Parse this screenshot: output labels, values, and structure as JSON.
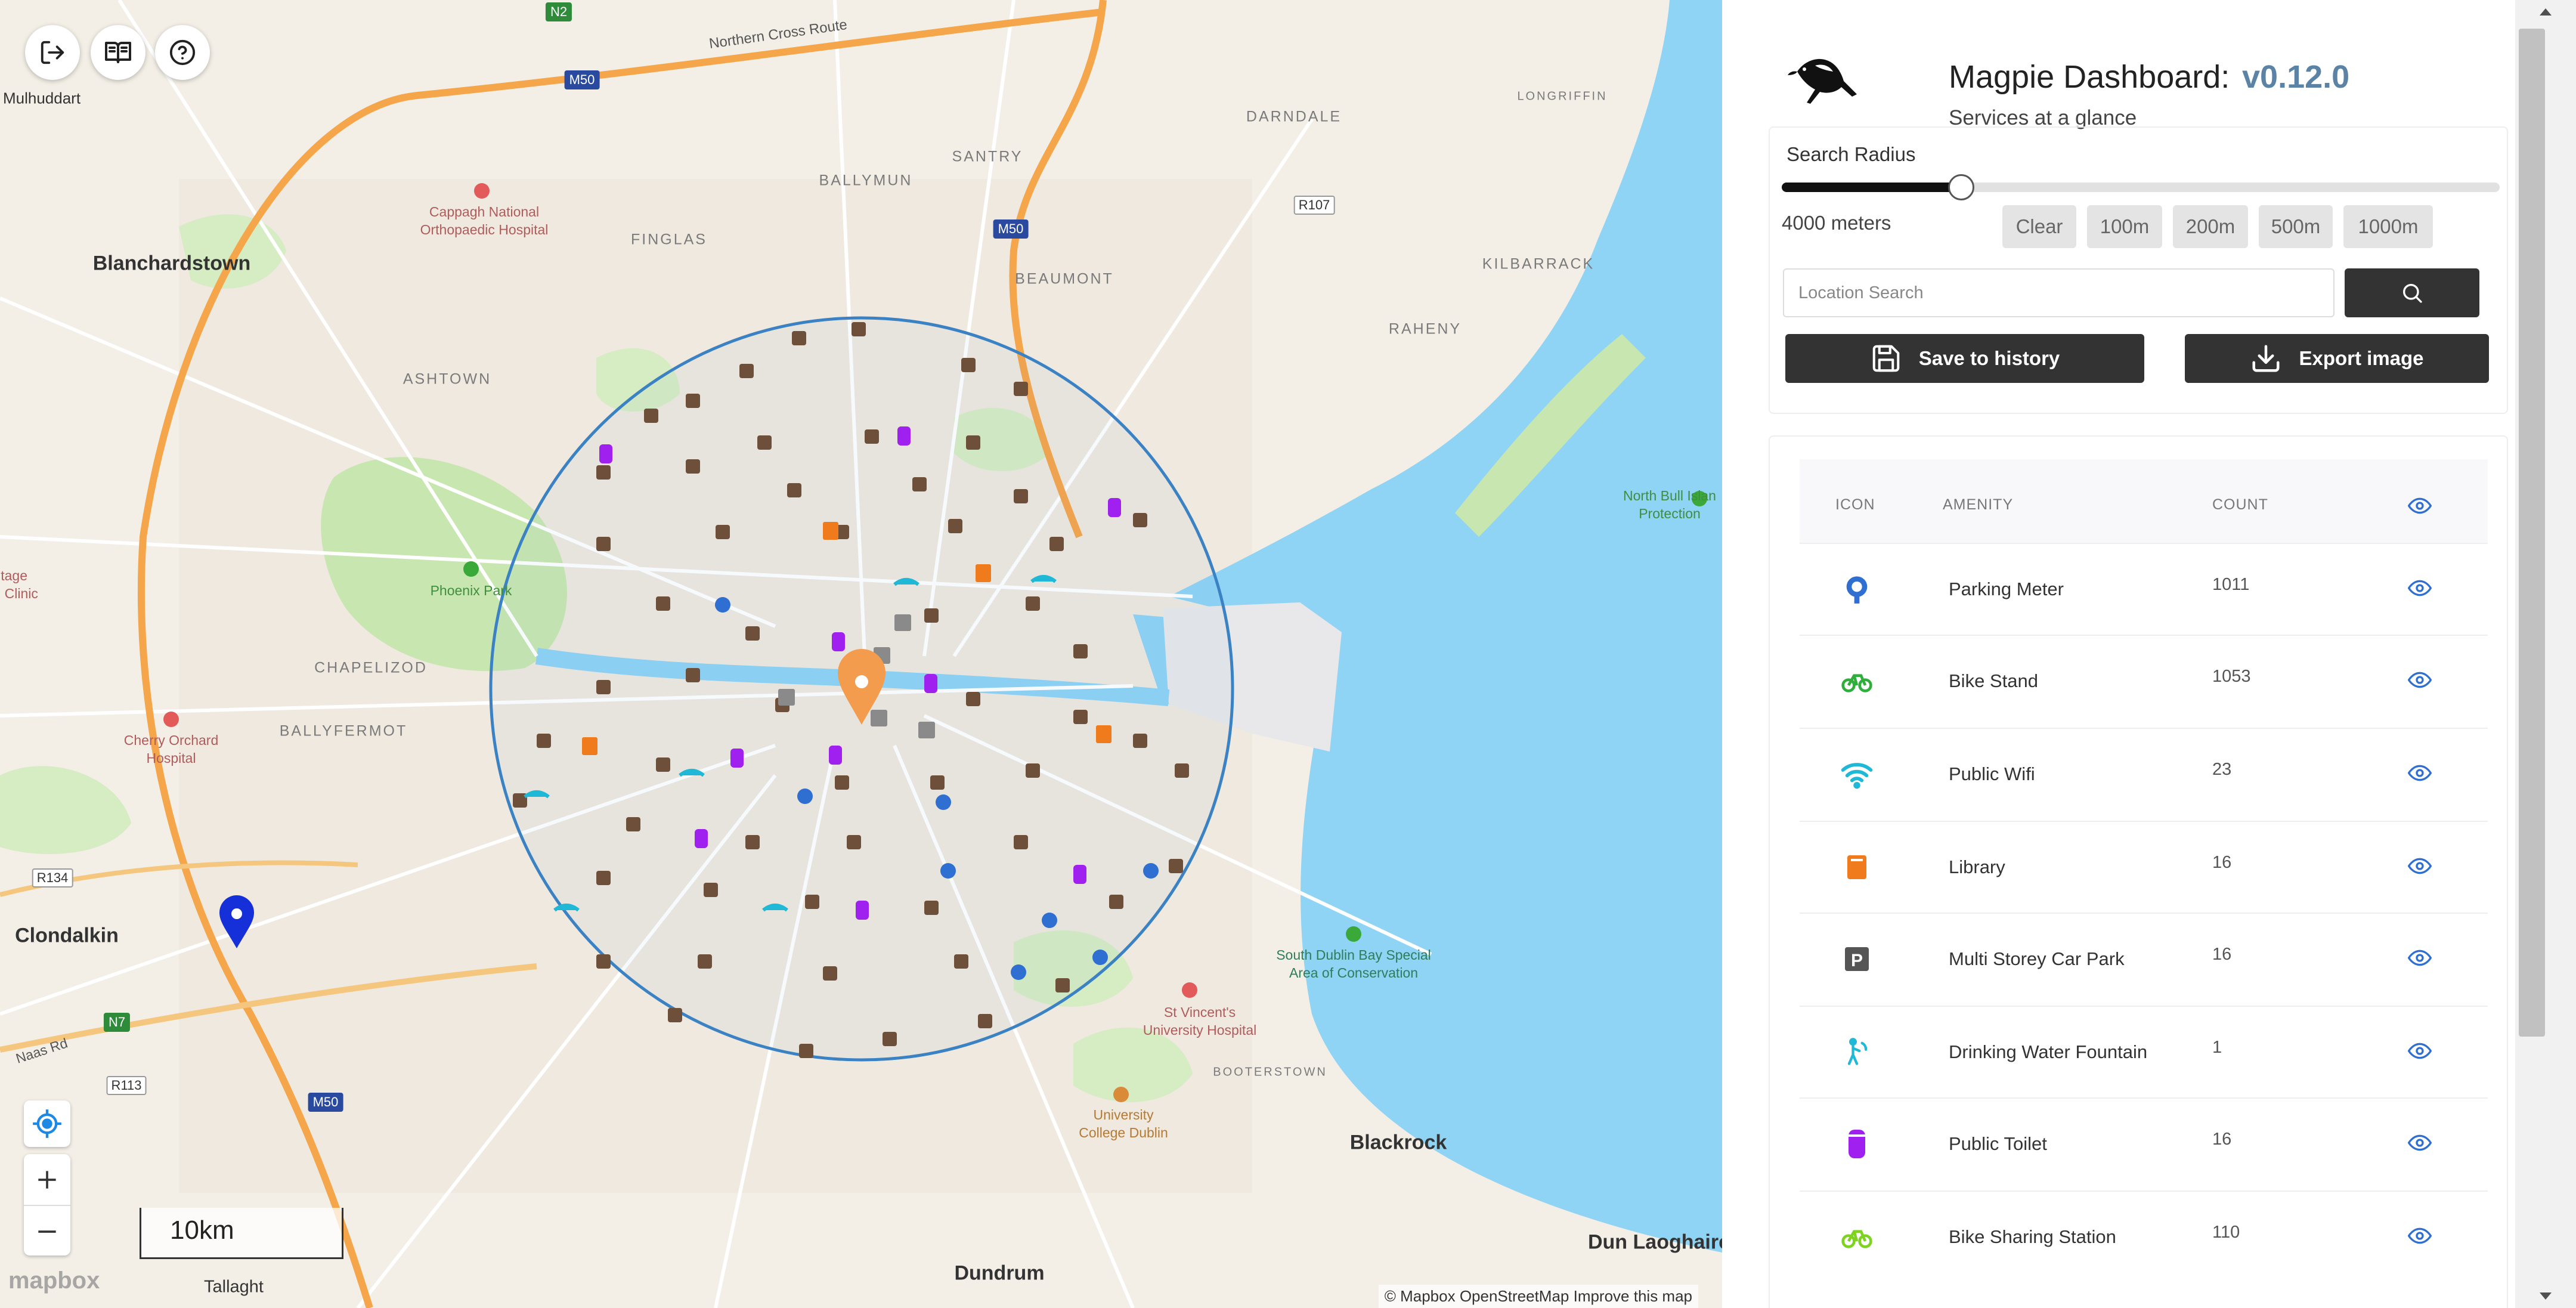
{
  "map": {
    "labels": {
      "blanchardstown": "Blanchardstown",
      "clondalkin": "Clondalkin",
      "blackrock": "Blackrock",
      "dundrum": "Dundrum",
      "dun_laoghaire": "Dun Laoghaire",
      "tallaght": "Tallaght",
      "mulhuddart": "Mulhuddart",
      "ballymun": "BALLYMUN",
      "santry": "SANTRY",
      "darndale": "DARNDALE",
      "finglas": "FINGLAS",
      "beaumont": "BEAUMONT",
      "kilbarrack": "KILBARRACK",
      "raheny": "RAHENY",
      "ashtown": "ASHTOWN",
      "chapelizod": "CHAPELIZOD",
      "ballyfermot": "BALLYFERMOT",
      "booterstown": "BOOTERSTOWN",
      "longmeadow": "LONGRIFFIN",
      "northern_cross": "Northern Cross Route",
      "naas_rd": "Naas Rd",
      "cappagh": "Cappagh National\nOrthopaedic Hospital",
      "cherry_orchard": "Cherry Orchard\nHospital",
      "st_vincents": "St Vincent's\nUniversity Hospital",
      "ucd": "University\nCollege Dublin",
      "phoenix_park": "Phoenix Park",
      "north_bull": "North Bull Islan\nProtection",
      "south_dublin_bay": "South Dublin Bay Special\nArea of Conservation",
      "clinic": "itage\nl Clinic",
      "r107": "R107",
      "m50a": "M50",
      "m50b": "M50",
      "m50c": "M50",
      "n2": "N2",
      "r134": "R134",
      "n7": "N7",
      "r113": "R113"
    },
    "scale_label": "10km",
    "attribution": "© Mapbox  OpenStreetMap  Improve this map",
    "mapbox_logo": "mapbox",
    "colors": {
      "water": "#8fd3f5",
      "park": "#c8e6b0",
      "radius_circle": "#3b82c4",
      "marker": "#f39c4d"
    }
  },
  "header": {
    "title": "Magpie Dashboard:",
    "version": "v0.12.0",
    "subtitle": "Services at a glance"
  },
  "controls": {
    "search_radius_label": "Search Radius",
    "radius_value": "4000 meters",
    "slider_fraction": 0.25,
    "chips": [
      "Clear",
      "100m",
      "200m",
      "500m",
      "1000m"
    ],
    "search_placeholder": "Location Search",
    "save_label": "Save to history",
    "export_label": "Export image"
  },
  "table": {
    "headers": {
      "icon": "ICON",
      "amenity": "AMENITY",
      "count": "COUNT"
    },
    "rows": [
      {
        "icon": "parking-meter-icon",
        "name": "Parking Meter",
        "count": "1011",
        "color": "#2f6fd1"
      },
      {
        "icon": "bike-stand-icon",
        "name": "Bike Stand",
        "count": "1053",
        "color": "#2fae3c"
      },
      {
        "icon": "wifi-icon",
        "name": "Public Wifi",
        "count": "23",
        "color": "#1fb8d6"
      },
      {
        "icon": "library-icon",
        "name": "Library",
        "count": "16",
        "color": "#f07b1c"
      },
      {
        "icon": "car-park-icon",
        "name": "Multi Storey Car Park",
        "count": "16",
        "color": "#555555"
      },
      {
        "icon": "water-fountain-icon",
        "name": "Drinking Water Fountain",
        "count": "1",
        "color": "#1fb8d6"
      },
      {
        "icon": "toilet-icon",
        "name": "Public Toilet",
        "count": "16",
        "color": "#a020f0"
      },
      {
        "icon": "bike-sharing-icon",
        "name": "Bike Sharing Station",
        "count": "110",
        "color": "#7ed321"
      }
    ]
  }
}
